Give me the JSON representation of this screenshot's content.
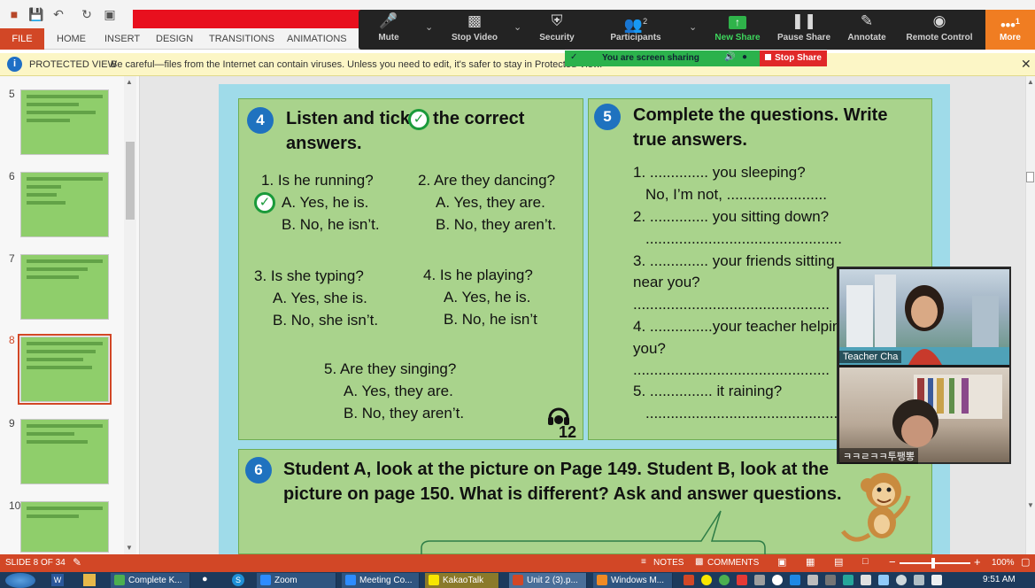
{
  "ribbon": {
    "file_tab": "FILE",
    "tabs": [
      "HOME",
      "INSERT",
      "DESIGN",
      "TRANSITIONS",
      "ANIMATIONS"
    ]
  },
  "zoom": {
    "buttons": {
      "mute": "Mute",
      "stop_video": "Stop Video",
      "security": "Security",
      "participants": "Participants",
      "participants_count": "2",
      "new_share": "New Share",
      "pause_share": "Pause Share",
      "annotate": "Annotate",
      "remote_control": "Remote Control",
      "more": "More",
      "more_badge": "1"
    },
    "sharing_banner": "You are screen sharing",
    "stop_share": "Stop Share",
    "participants": [
      "Teacher Cha",
      "ㅋㅋㄹㅋㅋ투팽뽕"
    ]
  },
  "protected_view": {
    "title": "PROTECTED VIEW",
    "message": "Be careful—files from the Internet can contain viruses. Unless you need to edit, it's safer to stay in Protected View."
  },
  "thumbnails": [
    {
      "num": "5",
      "active": false
    },
    {
      "num": "6",
      "active": false
    },
    {
      "num": "7",
      "active": false
    },
    {
      "num": "8",
      "active": true
    },
    {
      "num": "9",
      "active": false
    },
    {
      "num": "10",
      "active": false
    }
  ],
  "slide": {
    "section4": {
      "number": "4",
      "title_a": "Listen and tick",
      "title_b": "the correct",
      "title_c": "answers.",
      "q1": "1. Is he running?",
      "q1a": "A. Yes, he is.",
      "q1b": "B. No, he isn’t.",
      "q2": "2. Are they dancing?",
      "q2a": "A. Yes, they are.",
      "q2b": "B. No, they aren’t.",
      "q3": "3. Is she typing?",
      "q3a": "A. Yes, she is.",
      "q3b": "B. No, she isn’t.",
      "q4": "4. Is he playing?",
      "q4a": "A. Yes, he is.",
      "q4b": "B. No, he isn’t",
      "q5": "5. Are they singing?",
      "q5a": "A. Yes, they are.",
      "q5b": "B. No, they aren’t.",
      "track": "12"
    },
    "section5": {
      "number": "5",
      "title_a": "Complete the questions. Write",
      "title_b": "true answers.",
      "l1": "1. .............. you sleeping?",
      "l1b": "No, I’m not, ........................",
      "l2": "2. .............. you sitting down?",
      "l2b": "...............................................",
      "l3": "3. .............. your friends sitting",
      "l3b": "near you?",
      "l3c": "...............................................",
      "l4": "4. ...............your teacher helping",
      "l4b": "you?",
      "l4c": "...............................................",
      "l5": "5. ............... it raining?",
      "l5b": "..............................................."
    },
    "section6": {
      "number": "6",
      "title_a": "Student A, look at the picture on Page 149. Student B, look at the",
      "title_b": "picture on page 150. What is different? Ask and answer questions."
    }
  },
  "status": {
    "slide_info": "SLIDE 8 OF 34",
    "notes": "NOTES",
    "comments": "COMMENTS",
    "zoom": "100%"
  },
  "taskbar": {
    "items": [
      "Complete K...",
      "Zoom",
      "Meeting Co...",
      "KakaoTalk",
      "Unit 2 (3).p...",
      "Windows M..."
    ],
    "clock": "9:51 AM"
  }
}
